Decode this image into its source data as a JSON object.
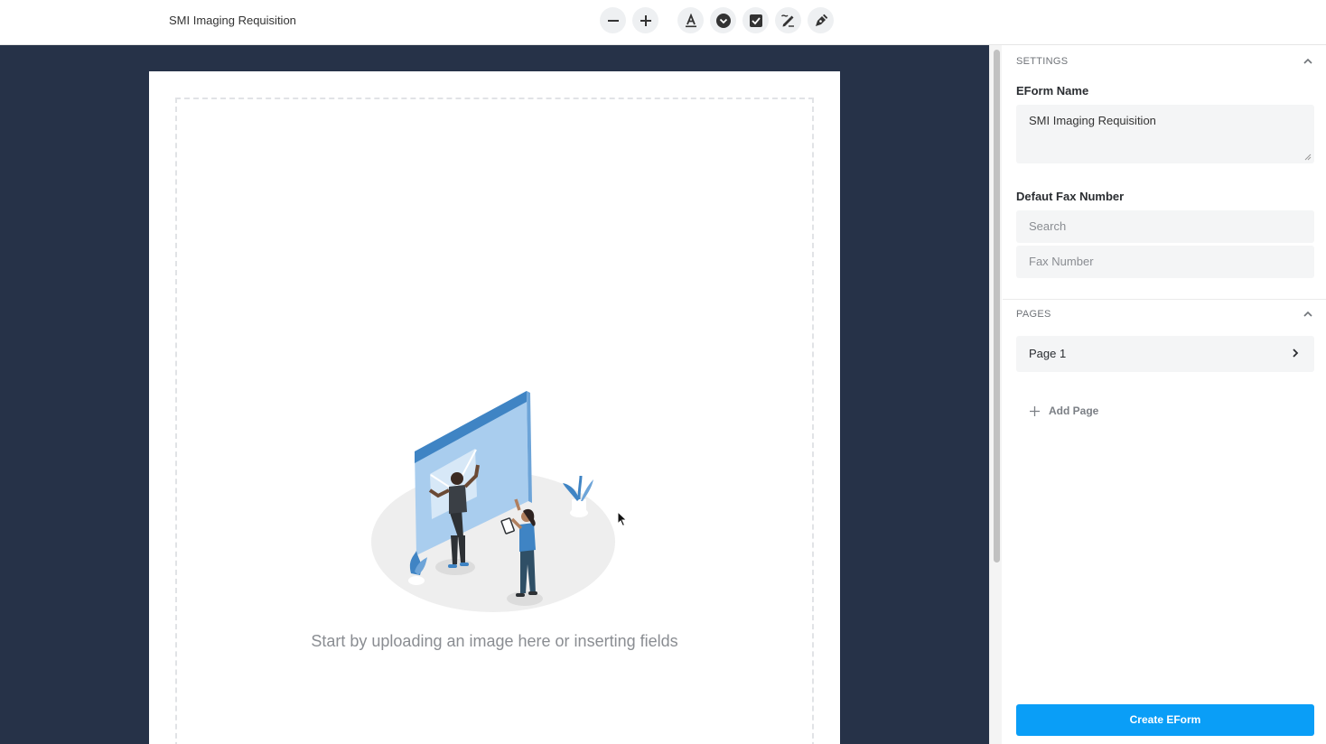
{
  "header": {
    "title": "SMI Imaging Requisition"
  },
  "toolbar": {
    "buttons": [
      {
        "icon": "minus-icon"
      },
      {
        "icon": "plus-icon"
      },
      {
        "icon": "text-field-icon"
      },
      {
        "icon": "dropdown-icon"
      },
      {
        "icon": "checkbox-icon"
      },
      {
        "icon": "signature-icon"
      },
      {
        "icon": "pen-icon"
      }
    ]
  },
  "canvas": {
    "empty_message": "Start by uploading an image here or inserting fields"
  },
  "sidebar": {
    "settings": {
      "heading": "SETTINGS",
      "eform_name_label": "EForm Name",
      "eform_name_value": "SMI Imaging Requisition",
      "fax_label": "Defaut Fax Number",
      "search_placeholder": "Search",
      "fax_placeholder": "Fax Number"
    },
    "pages": {
      "heading": "PAGES",
      "items": [
        {
          "label": "Page 1"
        }
      ],
      "add_label": "Add Page"
    },
    "create_button": "Create EForm"
  },
  "colors": {
    "canvas_background": "#263248",
    "primary_button": "#0a9ef7"
  }
}
